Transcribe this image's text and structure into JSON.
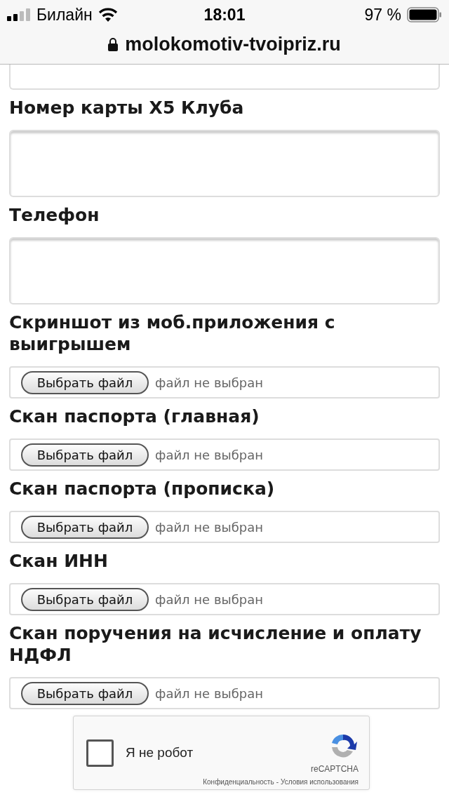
{
  "status_bar": {
    "carrier": "Билайн",
    "time": "18:01",
    "battery": "97 %"
  },
  "address_bar": {
    "url": "molokomotiv-tvoipriz.ru"
  },
  "form": {
    "fields": [
      {
        "kind": "text",
        "cut": true
      },
      {
        "kind": "text",
        "cut": false,
        "label": "Номер карты X5 Клуба"
      },
      {
        "kind": "text",
        "cut": false,
        "label": "Телефон"
      },
      {
        "kind": "file",
        "label": "Скриншот из моб.приложения с выигрышем",
        "button": "Выбрать файл",
        "status": "файл не выбран"
      },
      {
        "kind": "file",
        "label": "Скан паспорта (главная)",
        "button": "Выбрать файл",
        "status": "файл не выбран"
      },
      {
        "kind": "file",
        "label": "Скан паспорта (прописка)",
        "button": "Выбрать файл",
        "status": "файл не выбран"
      },
      {
        "kind": "file",
        "label": "Скан ИНН",
        "button": "Выбрать файл",
        "status": "файл не выбран"
      },
      {
        "kind": "file",
        "label": "Скан поручения на исчисление и оплату НДФЛ",
        "button": "Выбрать файл",
        "status": "файл не выбран"
      }
    ]
  },
  "captcha": {
    "label": "Я не робот",
    "checked": false,
    "brand": "reCAPTCHA",
    "privacy": "Конфиденциальность",
    "separator": "-",
    "terms": "Условия использования"
  }
}
